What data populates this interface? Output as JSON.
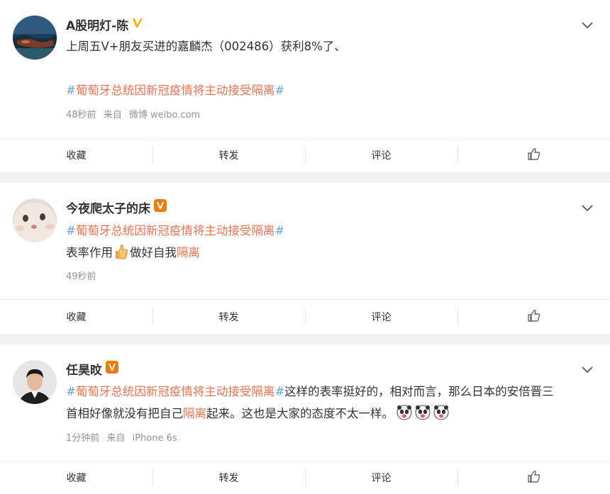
{
  "posts": [
    {
      "user": "A股明灯-陈",
      "badge": "gold-v",
      "text1": "上周五V+朋友买进的嘉麟杰（002486）获利8%了、",
      "topic": "葡萄牙总统因新冠疫情将主动接受隔离",
      "hash": "#",
      "time": "48秒前",
      "source_prefix": "来自",
      "source": "微博 weibo.com"
    },
    {
      "user": "今夜爬太子的床",
      "badge": "orange-v",
      "topic": "葡萄牙总统因新冠疫情将主动接受隔离",
      "hash": "#",
      "text_a": "表率作用",
      "text_b": "做好自我",
      "text_kw": "隔离",
      "time": "49秒前"
    },
    {
      "user": "任昊旼",
      "badge": "orange-v",
      "topic": "葡萄牙总统因新冠疫情将主动接受隔离",
      "hash": "#",
      "text_a": "这样的表率挺好的，相对而言，那么日本的安倍晋三",
      "text_b": "首相好像就没有把自己",
      "text_kw": "隔离",
      "text_c": "起来。这也是大家的态度不太一样。",
      "time": "1分钟前",
      "source_prefix": "来自",
      "source": "iPhone 6s"
    }
  ],
  "actions": {
    "collect": "收藏",
    "repost": "转发",
    "comment": "评论"
  },
  "colors": {
    "topic": "#eb7350",
    "hash": "#6ba5d9",
    "gold_v": "#f5b400",
    "orange_v": "#f07b00"
  }
}
